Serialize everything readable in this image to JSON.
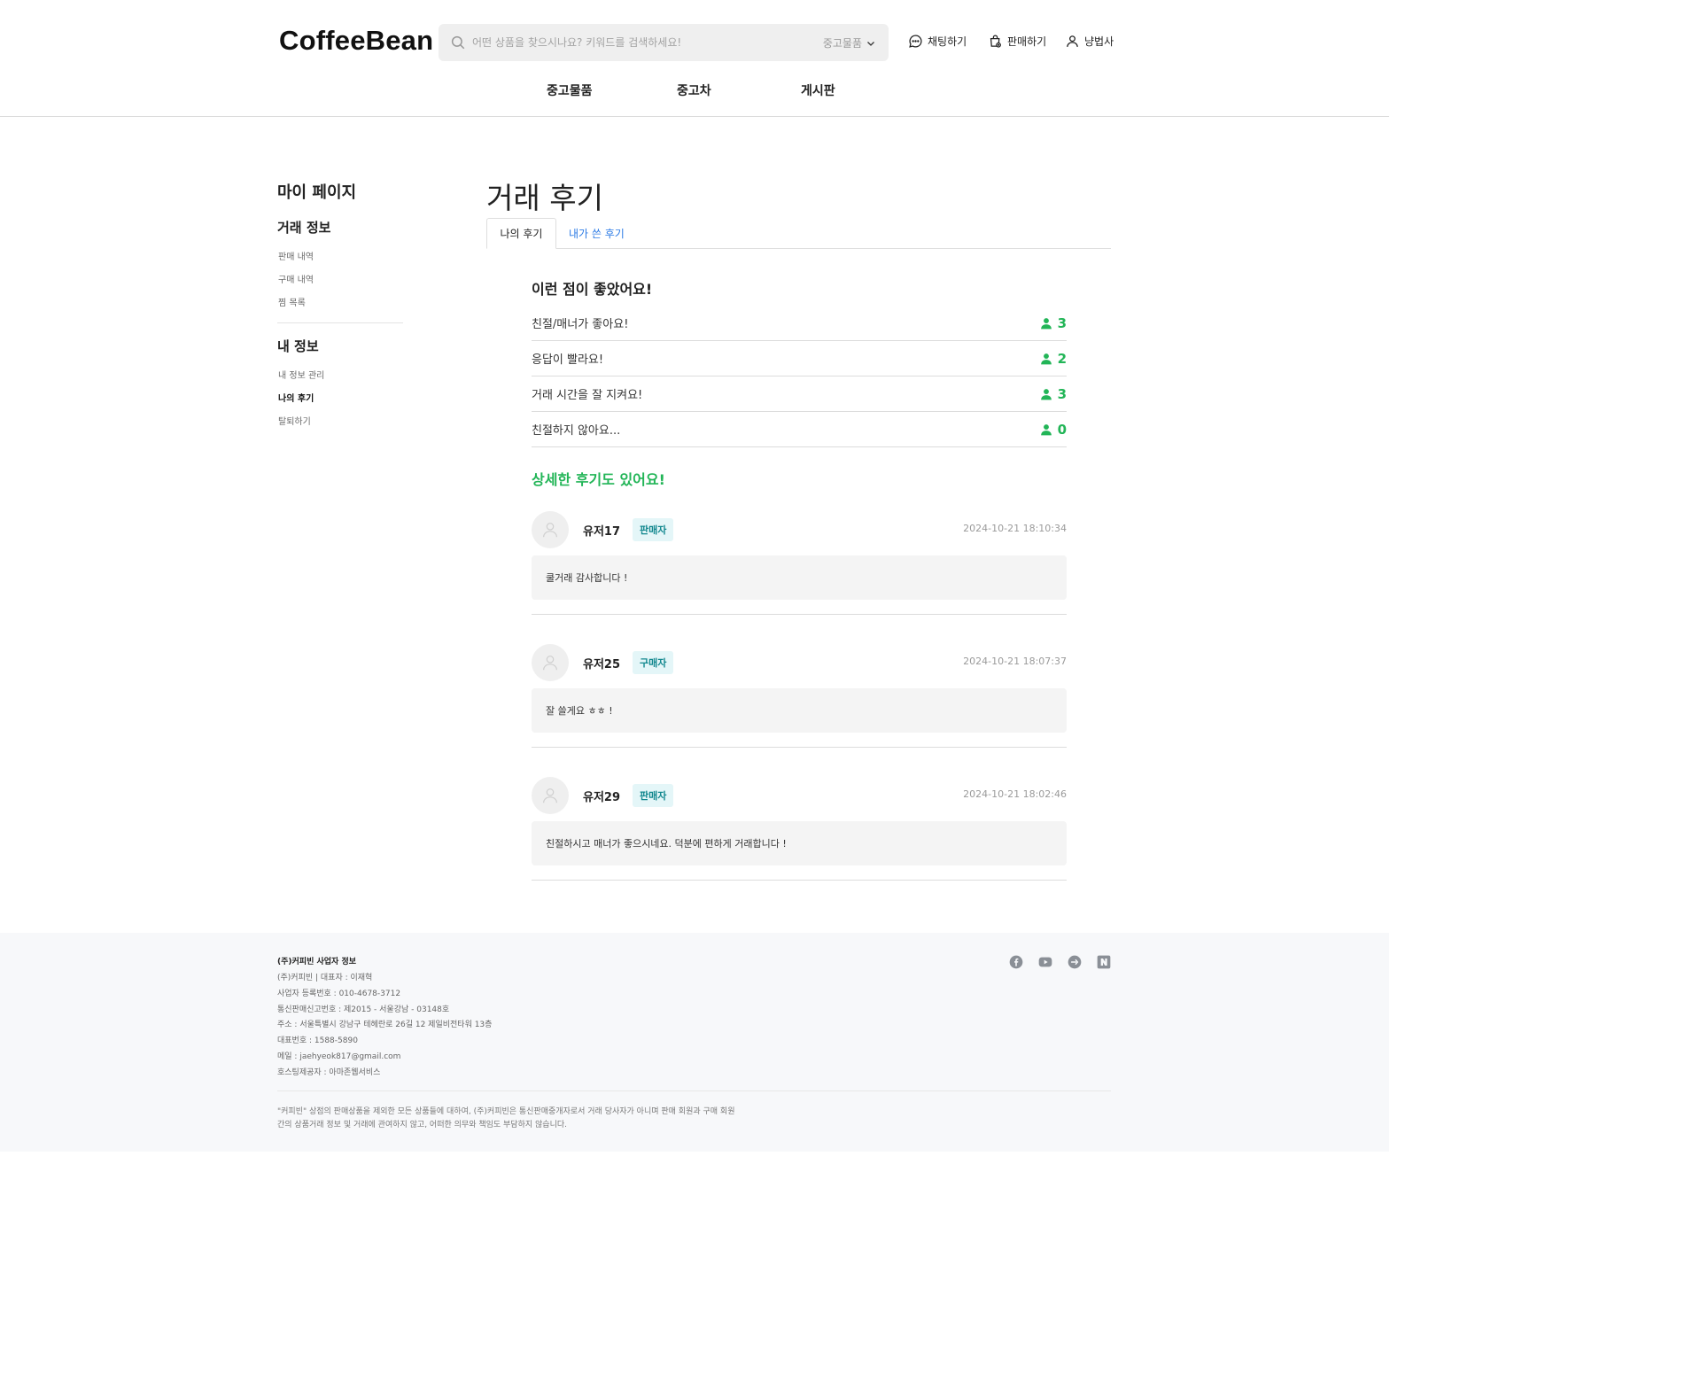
{
  "header": {
    "logo": "CoffeeBean",
    "search_placeholder": "어떤 상품을 찾으시나요? 키워드를 검색하세요!",
    "search_category": "중고물품",
    "links": {
      "chat": "채팅하기",
      "sell": "판매하기",
      "user": "냥법사"
    },
    "nav": [
      "중고물품",
      "중고차",
      "게시판"
    ]
  },
  "sidebar": {
    "title": "마이 페이지",
    "sections": [
      {
        "label": "거래 정보",
        "items": [
          "판매 내역",
          "구매 내역",
          "찜 목록"
        ]
      },
      {
        "label": "내 정보",
        "items": [
          "내 정보 관리",
          "나의 후기",
          "탈퇴하기"
        ]
      }
    ],
    "active_item": "나의 후기"
  },
  "main": {
    "title": "거래 후기",
    "tabs": [
      "나의 후기",
      "내가 쓴 후기"
    ],
    "good_title": "이런 점이 좋았어요!",
    "good_points": [
      {
        "label": "친절/매너가 좋아요!",
        "count": "3"
      },
      {
        "label": "응답이 빨라요!",
        "count": "2"
      },
      {
        "label": "거래 시간을 잘 지켜요!",
        "count": "3"
      },
      {
        "label": "친절하지 않아요...",
        "count": "0"
      }
    ],
    "detail_title": "상세한 후기도 있어요!",
    "reviews": [
      {
        "name": "유저17",
        "role": "판매자",
        "date": "2024-10-21 18:10:34",
        "text": "쿨거래 감사합니다 !"
      },
      {
        "name": "유저25",
        "role": "구매자",
        "date": "2024-10-21 18:07:37",
        "text": "잘 쓸게요 ㅎㅎ !"
      },
      {
        "name": "유저29",
        "role": "판매자",
        "date": "2024-10-21 18:02:46",
        "text": "친절하시고 매너가 좋으시네요. 덕분에 편하게 거래합니다 !"
      }
    ]
  },
  "footer": {
    "title": "(주)커피빈 사업자 정보",
    "lines": [
      "(주)커피빈 | 대표자 : 이재혁",
      "사업자 등록번호 : 010-4678-3712",
      "통신판매신고번호 : 제2015 - 서울강남 - 03148호",
      "주소 : 서울특별시 강남구 테헤란로 26길 12 제일비전타워 13층",
      "대표번호 : 1588-5890",
      "메일 : jaehyeok817@gmail.com",
      "호스팅제공자 : 아마존웹서비스"
    ],
    "notice": "\"커피빈\" 상점의 판매상품을 제외한 모든 상품들에 대하여, (주)커피빈은 통신판매중개자로서 거래 당사자가 아니며 판매 회원과 구매 회원 간의 상품거래 정보 및 거래에 관여하지 않고, 어떠한 의무와 책임도 부담하지 않습니다.",
    "social_icons": [
      "facebook-icon",
      "youtube-icon",
      "kakao-icon",
      "naver-icon"
    ]
  },
  "colors": {
    "accent_green": "#22b557",
    "tab_blue": "#2c7be5",
    "badge_bg": "#e4f6f8",
    "badge_text": "#13888f"
  }
}
